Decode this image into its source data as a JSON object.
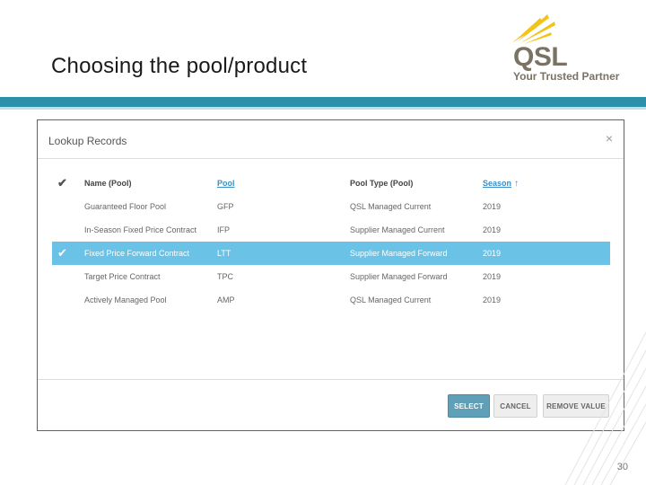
{
  "slide": {
    "title": "Choosing the pool/product",
    "page_number": "30"
  },
  "logo": {
    "word": "QSL",
    "tagline": "Your Trusted Partner",
    "accent": "#f2c418",
    "text_color": "#7a7262"
  },
  "dialog": {
    "title": "Lookup Records",
    "close_glyph": "×",
    "columns": {
      "check": "✔",
      "name": "Name (Pool)",
      "pool": "Pool",
      "pool_type": "Pool Type (Pool)",
      "season": "Season",
      "season_sort_icon": "🠕"
    },
    "rows": [
      {
        "check": "",
        "name": "Guaranteed Floor Pool",
        "pool": "GFP",
        "pool_type": "QSL Managed Current",
        "season": "2019"
      },
      {
        "check": "",
        "name": "In-Season Fixed Price Contract",
        "pool": "IFP",
        "pool_type": "Supplier Managed Current",
        "season": "2019"
      },
      {
        "check": "✔",
        "name": "Fixed Price Forward Contract",
        "pool": "LTT",
        "pool_type": "Supplier Managed Forward",
        "season": "2019"
      },
      {
        "check": "",
        "name": "Target Price Contract",
        "pool": "TPC",
        "pool_type": "Supplier Managed Forward",
        "season": "2019"
      },
      {
        "check": "",
        "name": "Actively Managed Pool",
        "pool": "AMP",
        "pool_type": "QSL Managed Current",
        "season": "2019"
      }
    ],
    "buttons": {
      "select": "SELECT",
      "cancel": "CANCEL",
      "remove": "REMOVE VALUE"
    }
  },
  "colors": {
    "teal_band": "#2e8fa8",
    "selected_row": "#6ac3e6",
    "frame": "#3f7a46"
  }
}
